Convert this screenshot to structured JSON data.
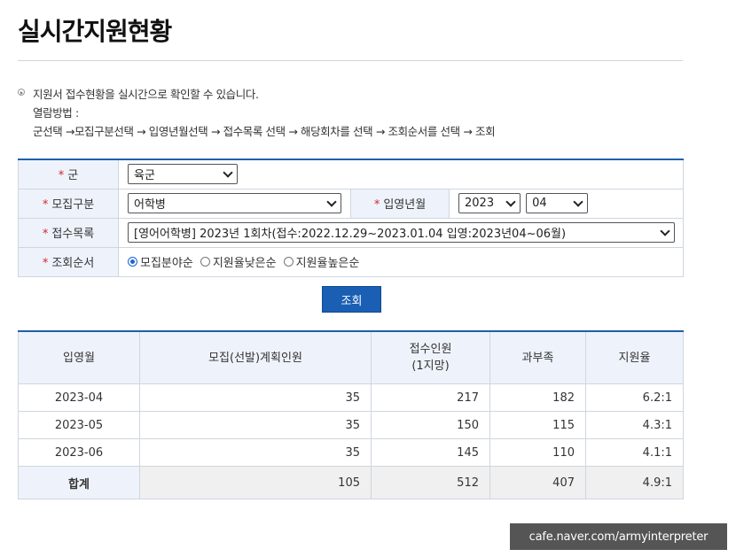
{
  "page_title": "실시간지원현황",
  "info": {
    "line1": "지원서 접수현황을 실시간으로 확인할 수 있습니다.",
    "line2": "열람방법 :",
    "line3": "군선택 →모집구분선택 → 입영년월선택 → 접수목록 선택 → 해당회차를 선택 → 조회순서를 선택 → 조회"
  },
  "form": {
    "required_mark": "*",
    "branch": {
      "label": "군",
      "value": "육군"
    },
    "category": {
      "label": "모집구분",
      "value": "어학병"
    },
    "enlist_month": {
      "label": "입영년월",
      "year": "2023",
      "month": "04"
    },
    "application_list": {
      "label": "접수목록",
      "value": "[영어어학병] 2023년 1회차(접수:2022.12.29~2023.01.04 입영:2023년04~06월)"
    },
    "sort_order": {
      "label": "조회순서",
      "options": [
        "모집분야순",
        "지원율낮은순",
        "지원율높은순"
      ],
      "selected_index": 0
    }
  },
  "search_button": "조회",
  "result": {
    "headers": [
      "입영월",
      "모집(선발)계획인원",
      "접수인원",
      "(1지망)",
      "과부족",
      "지원율"
    ],
    "rows": [
      {
        "month": "2023-04",
        "planned": "35",
        "applied": "217",
        "surplus": "182",
        "ratio": "6.2:1"
      },
      {
        "month": "2023-05",
        "planned": "35",
        "applied": "150",
        "surplus": "115",
        "ratio": "4.3:1"
      },
      {
        "month": "2023-06",
        "planned": "35",
        "applied": "145",
        "surplus": "110",
        "ratio": "4.1:1"
      }
    ],
    "total": {
      "label": "합계",
      "planned": "105",
      "applied": "512",
      "surplus": "407",
      "ratio": "4.9:1"
    }
  },
  "watermark": "cafe.naver.com/armyinterpreter"
}
